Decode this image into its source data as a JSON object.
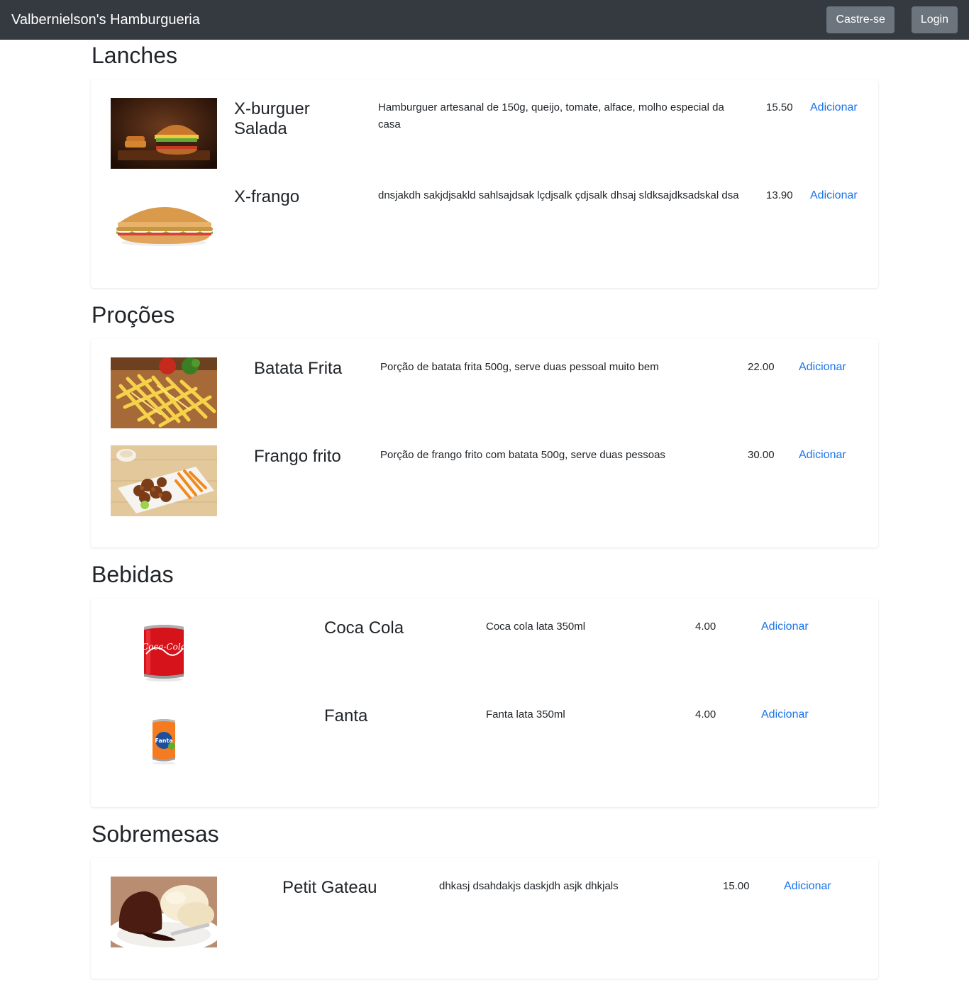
{
  "navbar": {
    "brand": "Valbernielson's Hamburgueria",
    "register_label": "Castre-se",
    "login_label": "Login"
  },
  "sections": [
    {
      "title": "Lanches",
      "items": [
        {
          "name": "X-burguer Salada",
          "description": "Hamburguer artesanal de 150g, queijo, tomate, alface, molho especial da casa",
          "price": "15.50",
          "action": "Adicionar"
        },
        {
          "name": "X-frango",
          "description": "dnsjakdh sakjdjsakld sahlsajdsak lçdjsalk çdjsalk dhsaj sldksajdksadskal dsa",
          "price": "13.90",
          "action": "Adicionar"
        }
      ]
    },
    {
      "title": "Proções",
      "items": [
        {
          "name": "Batata Frita",
          "description": "Porção de batata frita 500g, serve duas pessoal muito bem",
          "price": "22.00",
          "action": "Adicionar"
        },
        {
          "name": "Frango frito",
          "description": "Porção de frango frito com batata 500g, serve duas pessoas",
          "price": "30.00",
          "action": "Adicionar"
        }
      ]
    },
    {
      "title": "Bebidas",
      "items": [
        {
          "name": "Coca Cola",
          "description": "Coca cola lata 350ml",
          "price": "4.00",
          "action": "Adicionar"
        },
        {
          "name": "Fanta",
          "description": "Fanta lata 350ml",
          "price": "4.00",
          "action": "Adicionar"
        }
      ]
    },
    {
      "title": "Sobremesas",
      "items": [
        {
          "name": "Petit Gateau",
          "description": "dhkasj dsahdakjs daskjdh asjk dhkjals",
          "price": "15.00",
          "action": "Adicionar"
        }
      ]
    }
  ],
  "colors": {
    "navbar_bg": "#343a40",
    "nav_button_bg": "#6c757d",
    "link": "#1a73e8"
  },
  "icons": {
    "can_coca_text": "Coca-Cola",
    "can_fanta_text": "Fanta"
  }
}
